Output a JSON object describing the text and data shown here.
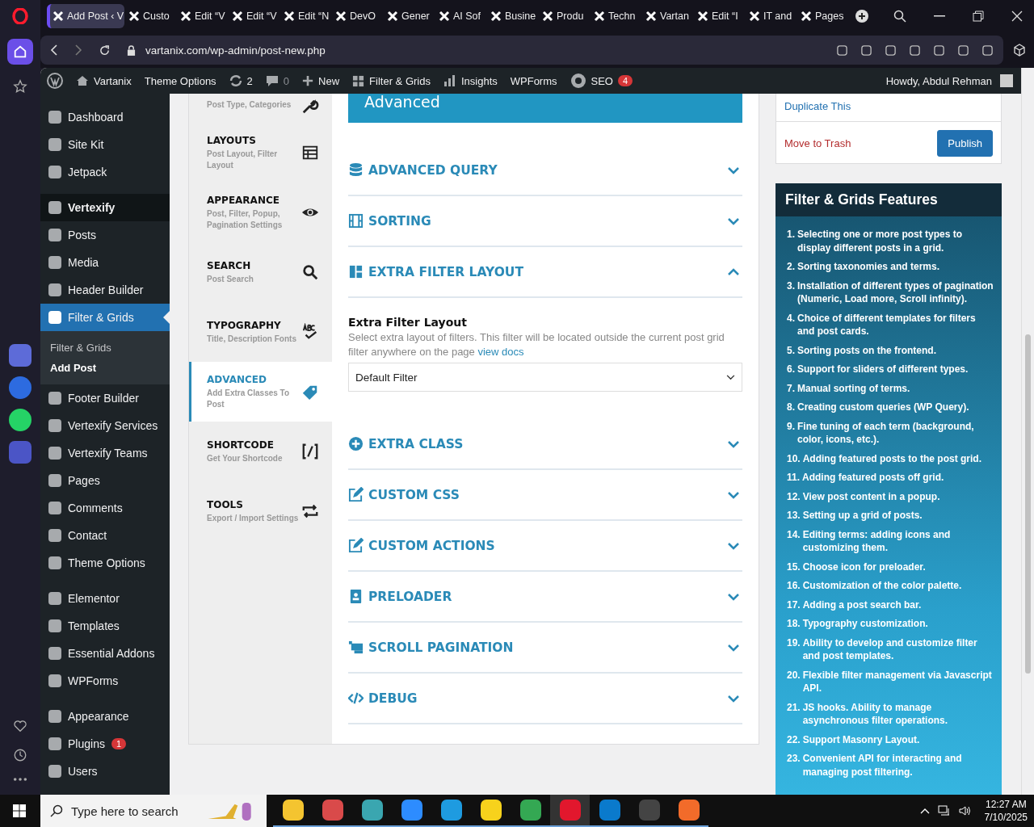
{
  "browser": {
    "tabs": [
      {
        "title": "Add Post ‹ V",
        "selected": true
      },
      {
        "title": "Custo",
        "selected": false
      },
      {
        "title": "Edit “V",
        "selected": false
      },
      {
        "title": "Edit “V",
        "selected": false
      },
      {
        "title": "Edit “N",
        "selected": false
      },
      {
        "title": "DevO",
        "selected": false
      },
      {
        "title": "Gener",
        "selected": false
      },
      {
        "title": "AI Sof",
        "selected": false
      },
      {
        "title": "Busine",
        "selected": false
      },
      {
        "title": "Produ",
        "selected": false
      },
      {
        "title": "Techn",
        "selected": false
      },
      {
        "title": "Vartan",
        "selected": false
      },
      {
        "title": "Edit “I",
        "selected": false
      },
      {
        "title": "IT and",
        "selected": false
      },
      {
        "title": "Pages",
        "selected": false
      }
    ],
    "url": "vartanix.com/wp-admin/post-new.php"
  },
  "admin_bar": {
    "items": [
      {
        "label": "Vartanix"
      },
      {
        "label": "Theme Options"
      },
      {
        "label": "2"
      },
      {
        "label": "0"
      },
      {
        "label": "New"
      },
      {
        "label": "Filter & Grids"
      },
      {
        "label": "Insights"
      },
      {
        "label": "WPForms"
      },
      {
        "label": "SEO",
        "badge": "4"
      }
    ],
    "howdy": "Howdy, Abdul Rehman"
  },
  "sidebar": {
    "groups": [
      [
        {
          "label": "Dashboard",
          "selected": false
        },
        {
          "label": "Site Kit",
          "selected": false
        },
        {
          "label": "Jetpack",
          "selected": false
        }
      ],
      [
        {
          "label": "Vertexify",
          "selected": false,
          "hover": true
        },
        {
          "label": "Posts",
          "selected": false
        },
        {
          "label": "Media",
          "selected": false
        },
        {
          "label": "Header Builder",
          "selected": false
        },
        {
          "label": "Filter & Grids",
          "selected": true,
          "children": [
            {
              "label": "Filter & Grids",
              "selected": false
            },
            {
              "label": "Add Post",
              "selected": true
            }
          ]
        },
        {
          "label": "Footer Builder",
          "selected": false
        },
        {
          "label": "Vertexify Services",
          "selected": false
        },
        {
          "label": "Vertexify Teams",
          "selected": false
        },
        {
          "label": "Pages",
          "selected": false
        },
        {
          "label": "Comments",
          "selected": false
        },
        {
          "label": "Contact",
          "selected": false
        },
        {
          "label": "Theme Options",
          "selected": false
        }
      ],
      [
        {
          "label": "Elementor",
          "selected": false
        },
        {
          "label": "Templates",
          "selected": false
        },
        {
          "label": "Essential Addons",
          "selected": false
        },
        {
          "label": "WPForms",
          "selected": false
        }
      ],
      [
        {
          "label": "Appearance",
          "selected": false
        },
        {
          "label": "Plugins",
          "selected": false,
          "badge": "1"
        },
        {
          "label": "Users",
          "selected": false
        }
      ]
    ]
  },
  "settings": {
    "tabs": [
      {
        "subtitle": "Post Type, Categories",
        "selected": false
      },
      {
        "title": "LAYOUTS",
        "subtitle": "Post Layout, Filter Layout",
        "selected": false
      },
      {
        "title": "APPEARANCE",
        "subtitle": "Post, Filter, Popup, Pagination Settings",
        "selected": false
      },
      {
        "title": "SEARCH",
        "subtitle": "Post Search",
        "selected": false
      },
      {
        "title": "TYPOGRAPHY",
        "subtitle": "Title, Description Fonts",
        "selected": false
      },
      {
        "title": "ADVANCED",
        "subtitle": "Add Extra Classes To Post",
        "selected": true
      },
      {
        "title": "SHORTCODE",
        "subtitle": "Get Your Shortcode",
        "selected": false
      },
      {
        "title": "TOOLS",
        "subtitle": "Export / Import Settings",
        "selected": false
      }
    ],
    "heading": "Advanced",
    "sections": [
      {
        "title": "ADVANCED QUERY",
        "expanded": false
      },
      {
        "title": "SORTING",
        "expanded": false
      },
      {
        "title": "EXTRA FILTER LAYOUT",
        "expanded": true,
        "field": {
          "label": "Extra Filter Layout",
          "description": "Select extra layout of filters. This filter will be located outside the current post grid filter anywhere on the page",
          "link": "view docs",
          "value": "Default Filter"
        }
      },
      {
        "title": "EXTRA CLASS",
        "expanded": false
      },
      {
        "title": "CUSTOM CSS",
        "expanded": false
      },
      {
        "title": "CUSTOM ACTIONS",
        "expanded": false
      },
      {
        "title": "PRELOADER",
        "expanded": false
      },
      {
        "title": "SCROLL PAGINATION",
        "expanded": false
      },
      {
        "title": "DEBUG",
        "expanded": false
      }
    ]
  },
  "publish_box": {
    "duplicate": "Duplicate This",
    "trash": "Move to Trash",
    "publish": "Publish"
  },
  "features": {
    "title": "Filter & Grids Features",
    "items": [
      {
        "num": "1.",
        "text": "Selecting one or more post types to display different posts in a grid."
      },
      {
        "num": "2.",
        "text": "Sorting taxonomies and terms."
      },
      {
        "num": "3.",
        "text": "Installation of different types of pagination (Numeric, Load more, Scroll infinity)."
      },
      {
        "num": "4.",
        "text": "Choice of different templates for filters and post cards."
      },
      {
        "num": "5.",
        "text": "Sorting posts on the frontend."
      },
      {
        "num": "6.",
        "text": "Support for sliders of different types."
      },
      {
        "num": "7.",
        "text": "Manual sorting of terms."
      },
      {
        "num": "8.",
        "text": "Creating custom queries (WP Query)."
      },
      {
        "num": "9.",
        "text": "Fine tuning of each term (background, color, icons, etc.)."
      },
      {
        "num": "10.",
        "text": "Adding featured posts to the post grid."
      },
      {
        "num": "11.",
        "text": "Adding featured posts off grid."
      },
      {
        "num": "12.",
        "text": "View post content in a popup."
      },
      {
        "num": "13.",
        "text": "Setting up a grid of posts."
      },
      {
        "num": "14.",
        "text": "Editing terms: adding icons and customizing them."
      },
      {
        "num": "15.",
        "text": "Choose icon for preloader."
      },
      {
        "num": "16.",
        "text": "Customization of the color palette."
      },
      {
        "num": "17.",
        "text": "Adding a post search bar."
      },
      {
        "num": "18.",
        "text": "Typography customization."
      },
      {
        "num": "19.",
        "text": "Ability to develop and customize filter and post templates."
      },
      {
        "num": "20.",
        "text": "Flexible filter management via Javascript API."
      },
      {
        "num": "21.",
        "text": "JS hooks. Ability to manage asynchronous filter operations."
      },
      {
        "num": "22.",
        "text": "Support Masonry Layout."
      },
      {
        "num": "23.",
        "text": "Convenient API for interacting and managing post filtering."
      }
    ]
  },
  "taskbar": {
    "search_placeholder": "Type here to search",
    "apps": [
      {
        "color": "#f4c430",
        "selected": false
      },
      {
        "color": "#d94a4a",
        "selected": false
      },
      {
        "color": "#3aa6b0",
        "selected": false
      },
      {
        "color": "#2d8cff",
        "selected": false
      },
      {
        "color": "#1e9be0",
        "selected": false
      },
      {
        "color": "#f7d21c",
        "selected": false
      },
      {
        "color": "#34a853",
        "selected": false
      },
      {
        "color": "#e2172d",
        "selected": true
      },
      {
        "color": "#0a7acc",
        "selected": false
      },
      {
        "color": "#444444",
        "selected": false
      },
      {
        "color": "#f26b2a",
        "selected": false
      }
    ],
    "time": "12:27 AM",
    "date": "7/10/2025"
  }
}
